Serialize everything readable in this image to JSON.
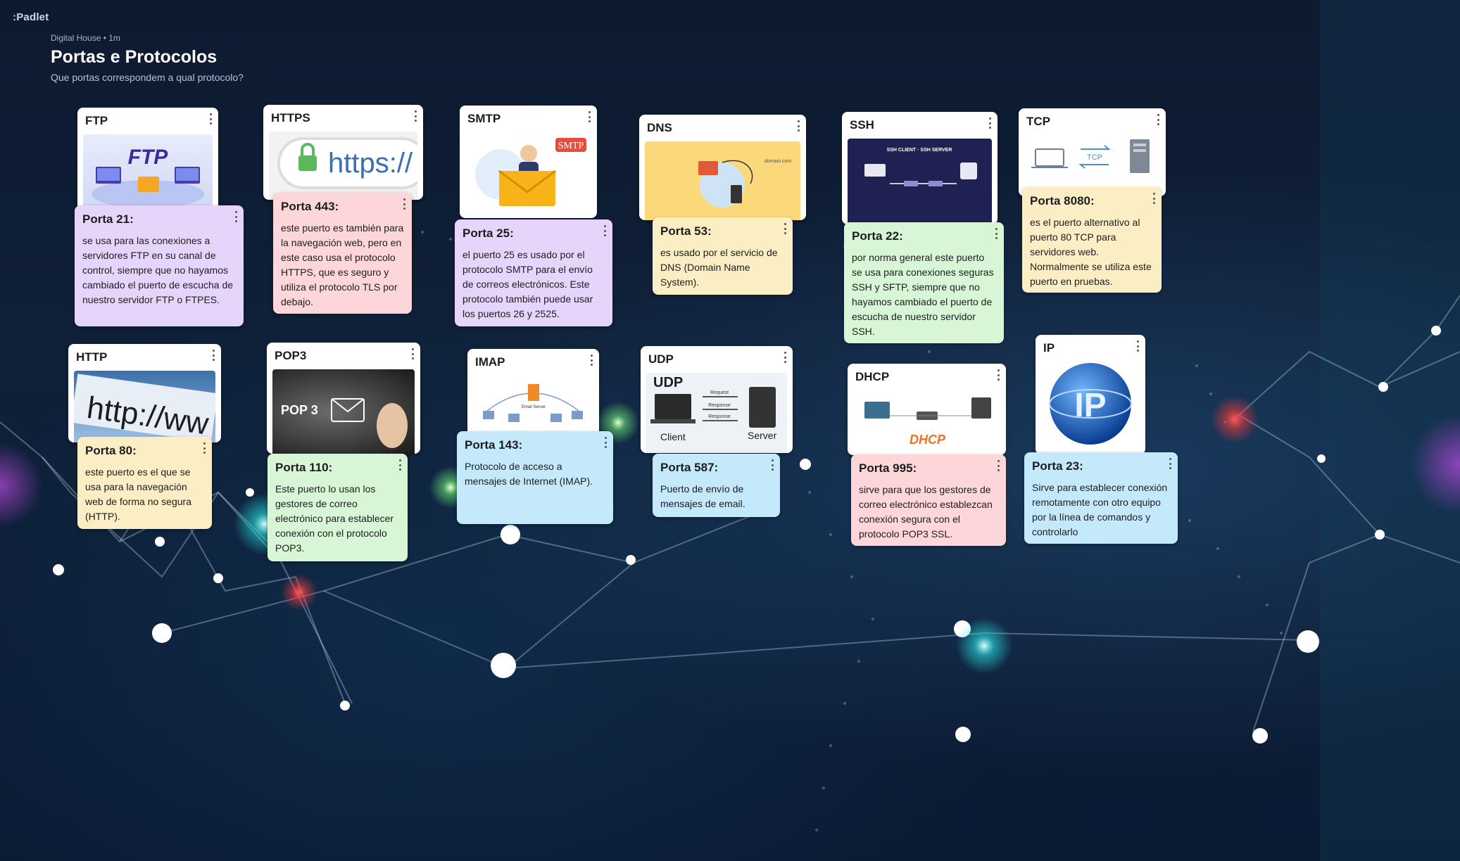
{
  "app": {
    "brand": "Padlet"
  },
  "header": {
    "meta": "Digital House • 1m",
    "title": "Portas e Protocolos",
    "subtitle": "Que portas correspondem a qual protocolo?"
  },
  "cards": [
    {
      "title": "FTP",
      "image_text": "FTP"
    },
    {
      "title": "HTTPS",
      "image_text": "https://"
    },
    {
      "title": "SMTP",
      "image_text": "SMTP"
    },
    {
      "title": "DNS",
      "image_text": "domain.com"
    },
    {
      "title": "SSH",
      "image_text": "SSH CLIENT · SSH SERVER"
    },
    {
      "title": "TCP",
      "image_text": "TCP"
    },
    {
      "title": "HTTP",
      "image_text": "http://ww"
    },
    {
      "title": "POP3",
      "image_text": "POP 3"
    },
    {
      "title": "IMAP",
      "image_text": "Email Server"
    },
    {
      "title": "UDP",
      "image_text": "UDP",
      "client": "Client",
      "server": "Server",
      "request": "Request",
      "response": "Response"
    },
    {
      "title": "DHCP",
      "image_text": "DHCP"
    },
    {
      "title": "IP",
      "image_text": "IP"
    }
  ],
  "notes": [
    {
      "title": "Porta 21:",
      "body": "se usa para las conexiones a servidores FTP en su canal de control, siempre que no hayamos cambiado el puerto de escucha de nuestro servidor FTP o FTPES."
    },
    {
      "title": "Porta 443:",
      "body": "este puerto es también para la navegación web, pero en este caso usa el protocolo HTTPS, que es seguro y utiliza el protocolo TLS por debajo."
    },
    {
      "title": "Porta 25:",
      "body": "el puerto 25 es usado por el protocolo SMTP para el envío de correos electrónicos. Este protocolo también puede usar los puertos 26 y 2525."
    },
    {
      "title": "Porta 53:",
      "body": "es usado por el servicio de DNS (Domain Name System)."
    },
    {
      "title": "Porta 22:",
      "body": "por norma general este puerto se usa para conexiones seguras SSH y SFTP, siempre que no hayamos cambiado el puerto de escucha de nuestro servidor SSH."
    },
    {
      "title": "Porta 8080:",
      "body": "es el puerto alternativo al puerto 80 TCP para servidores web. Normalmente se utiliza este puerto en pruebas."
    },
    {
      "title": "Porta 80:",
      "body": "este puerto es el que se usa para la navegación web de forma no segura (HTTP)."
    },
    {
      "title": "Porta 110:",
      "body": "Este puerto lo usan los gestores de correo electrónico para establecer conexión con el protocolo POP3."
    },
    {
      "title": "Porta 143:",
      "body": "Protocolo de acceso a mensajes de Internet (IMAP)."
    },
    {
      "title": "Porta 587:",
      "body": "Puerto de envío de mensajes de email."
    },
    {
      "title": "Porta 995:",
      "body": "sirve para que los gestores de correo electrónico establezcan conexión segura con el protocolo POP3 SSL."
    },
    {
      "title": "Porta 23:",
      "body": "Sirve para establecer conexión remotamente con otro equipo por la línea de comandos y controlarlo"
    }
  ]
}
